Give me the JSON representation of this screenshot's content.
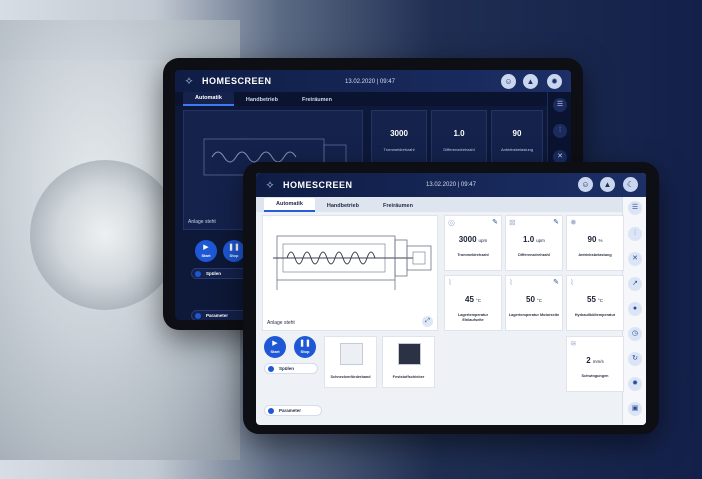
{
  "app": {
    "title": "HOMESCREEN",
    "datetime": "13.02.2020 | 09:47"
  },
  "tabs": [
    "Automatik",
    "Handbetrieb",
    "Freiräumen"
  ],
  "diagram": {
    "status_label": "Anlage steht"
  },
  "metrics": [
    {
      "value": "3000",
      "unit": "upm",
      "label": "Trommeldrehzahl",
      "editable": true
    },
    {
      "value": "1.0",
      "unit": "upm",
      "label": "Differenzdrehzahl",
      "editable": true
    },
    {
      "value": "90",
      "unit": "%",
      "label": "Antriebsbelastung",
      "editable": false
    },
    {
      "value": "45",
      "unit": "°C",
      "label": "Lagertemperatur Einlaufseite",
      "editable": false
    },
    {
      "value": "50",
      "unit": "°C",
      "label": "Lagertemperatur Motorseite",
      "editable": true
    },
    {
      "value": "55",
      "unit": "°C",
      "label": "Hydrauliköltemperatur",
      "editable": false
    },
    {
      "value": "2",
      "unit": "mm/s",
      "label": "Schwingungen",
      "editable": false
    }
  ],
  "controls": {
    "start_label": "Start",
    "stop_label": "Stop",
    "spuelen_label": "Spülen",
    "parameter_label": "Parameter"
  },
  "equipment": [
    {
      "label": "Schneckenförderband"
    },
    {
      "label": "Feststoffschieber"
    }
  ],
  "back_screen": {
    "metrics": [
      {
        "value": "3000",
        "unit": "upm",
        "label": "Trommeldrehzahl"
      },
      {
        "value": "1.0",
        "unit": "upm",
        "label": "Differenzdrehzahl"
      },
      {
        "value": "90",
        "unit": "%",
        "label": "Antriebsbelastung"
      }
    ],
    "status_label": "Anlage steht",
    "start_label": "Start",
    "stop_label": "Stop",
    "spuelen_label": "Spülen",
    "parameter_label": "Parameter"
  },
  "colors": {
    "accent": "#1e58d6",
    "header": "#0f1d45"
  }
}
